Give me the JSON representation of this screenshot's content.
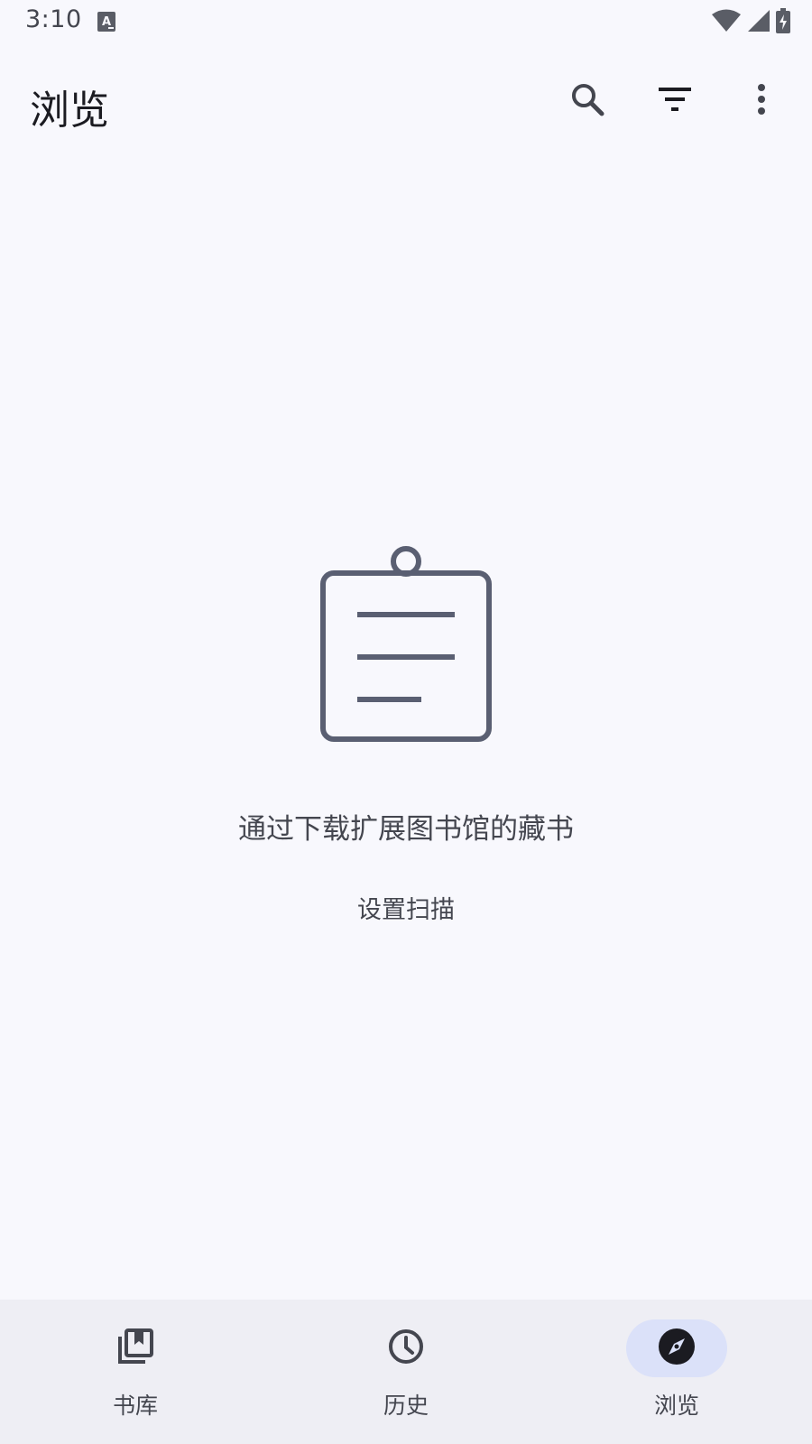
{
  "status_bar": {
    "time": "3:10",
    "app_icon": "a-text-icon",
    "icons": [
      "wifi-icon",
      "signal-icon",
      "battery-charging-icon"
    ]
  },
  "top_bar": {
    "title": "浏览",
    "actions": [
      "search-icon",
      "filter-icon",
      "more-vert-icon"
    ]
  },
  "empty_state": {
    "icon": "clipboard-list-icon",
    "message": "通过下载扩展图书馆的藏书",
    "action_label": "设置扫描"
  },
  "bottom_nav": {
    "items": [
      {
        "label": "书库",
        "icon": "library-books-icon",
        "active": false
      },
      {
        "label": "历史",
        "icon": "history-clock-icon",
        "active": false
      },
      {
        "label": "浏览",
        "icon": "explore-compass-icon",
        "active": true
      }
    ]
  },
  "colors": {
    "background": "#f8f8fd",
    "nav_background": "#eeeef4",
    "active_indicator": "#dbe1f9",
    "icon_muted": "#5a5f72",
    "text_primary": "#1b1b21",
    "text_secondary": "#44464f"
  }
}
